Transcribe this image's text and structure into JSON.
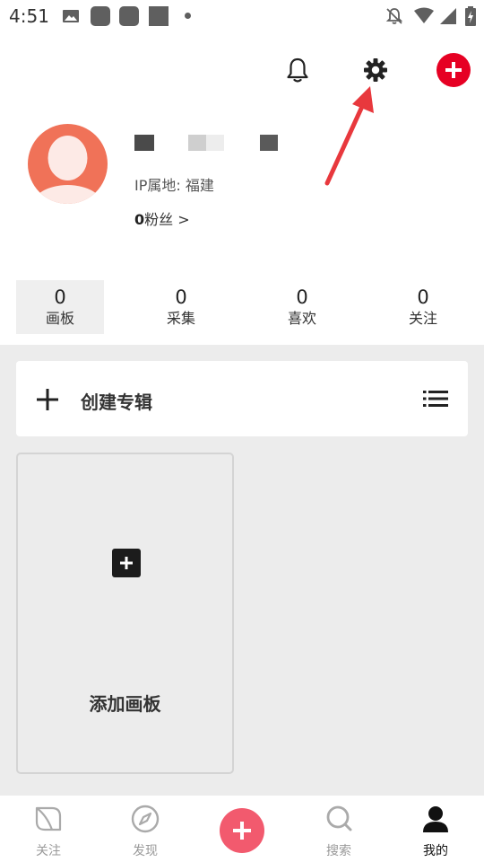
{
  "status_bar": {
    "time": "4:51",
    "icons": [
      "image-icon",
      "notification-icon",
      "notification-icon",
      "notification-icon",
      "dot-icon",
      "bell-off-icon",
      "wifi-icon",
      "signal-icon",
      "battery-charging-icon"
    ]
  },
  "header": {
    "actions": [
      "bell-icon",
      "settings-gear-icon",
      "add-icon"
    ],
    "accent_color": "#e60023"
  },
  "profile": {
    "ip_location": "IP属地: 福建",
    "fans_count": "0",
    "fans_label": "粉丝 >"
  },
  "stats": [
    {
      "count": "0",
      "label": "画板"
    },
    {
      "count": "0",
      "label": "采集"
    },
    {
      "count": "0",
      "label": "喜欢"
    },
    {
      "count": "0",
      "label": "关注"
    }
  ],
  "create_album": {
    "label": "创建专辑"
  },
  "add_board": {
    "label": "添加画板"
  },
  "bottom_nav": [
    {
      "label": "关注",
      "icon": "leaf-icon"
    },
    {
      "label": "发现",
      "icon": "compass-icon"
    },
    {
      "label": "",
      "icon": "add-icon"
    },
    {
      "label": "搜索",
      "icon": "search-icon"
    },
    {
      "label": "我的",
      "icon": "user-icon"
    }
  ],
  "colors": {
    "annotation_arrow": "#e8383d",
    "center_button": "#f25a6e",
    "avatar_bg": "#f07258"
  }
}
